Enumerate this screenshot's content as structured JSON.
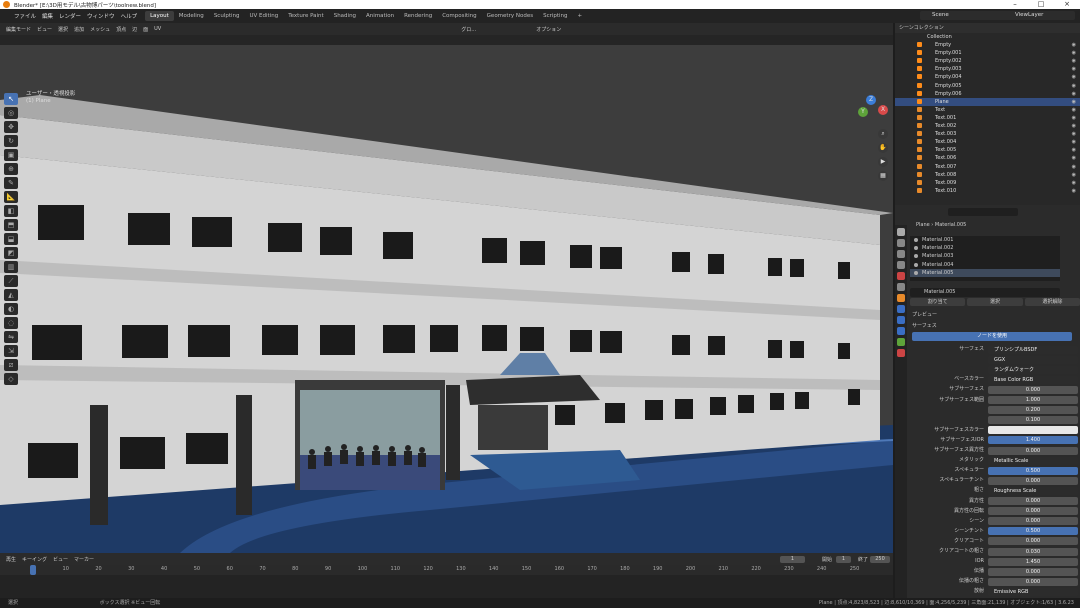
{
  "titlebar": {
    "title": "Blender* [E:\\3D用モデル\\古物博パーツ\\toolnew.blend]"
  },
  "menu": [
    "ファイル",
    "編集",
    "レンダー",
    "ウィンドウ",
    "ヘルプ"
  ],
  "workspaces": [
    "Layout",
    "Modeling",
    "Sculpting",
    "UV Editing",
    "Texture Paint",
    "Shading",
    "Animation",
    "Rendering",
    "Compositing",
    "Geometry Nodes",
    "Scripting",
    "+"
  ],
  "scene": "Scene",
  "view_layer": "ViewLayer",
  "viewport_header": [
    "編集モード",
    "ビュー",
    "選択",
    "追加",
    "メッシュ",
    "頂点",
    "辺",
    "面",
    "UV"
  ],
  "viewport_header_right": [
    "グロ…",
    "オプション"
  ],
  "viewport_info": {
    "line1": "ユーザー・透視投影",
    "line2": "(1) Plane"
  },
  "outliner": {
    "header": "シーンコレクション",
    "collection": "Collection",
    "items": [
      "Empty",
      "Empty.001",
      "Empty.002",
      "Empty.003",
      "Empty.004",
      "Empty.005",
      "Empty.006",
      "Plane",
      "Text",
      "Text.001",
      "Text.002",
      "Text.003",
      "Text.004",
      "Text.005",
      "Text.006",
      "Text.007",
      "Text.008",
      "Text.009",
      "Text.010"
    ],
    "selected": "Plane"
  },
  "properties": {
    "breadcrumb_obj": "Plane",
    "breadcrumb_mat": "Material.005",
    "materials": [
      "Material.001",
      "Material.002",
      "Material.003",
      "Material.004",
      "Material.005"
    ],
    "material_name": "Material.005",
    "buttons": [
      "割り当て",
      "選択",
      "選択解除"
    ],
    "section_preview": "プレビュー",
    "section_surface": "サーフェス",
    "use_nodes": "ノードを使用",
    "rows": [
      {
        "label": "サーフェス",
        "value": "プリンシプルBSDF",
        "kind": "dark"
      },
      {
        "label": "",
        "value": "GGX",
        "kind": "dark"
      },
      {
        "label": "",
        "value": "ランダムウォーク",
        "kind": "dark"
      },
      {
        "label": "ベースカラー",
        "value": "Base Color RGB",
        "kind": "dark"
      },
      {
        "label": "サブサーフェス",
        "value": "0.000",
        "kind": ""
      },
      {
        "label": "サブサーフェス範囲",
        "value": "1.000",
        "kind": ""
      },
      {
        "label": "",
        "value": "0.200",
        "kind": ""
      },
      {
        "label": "",
        "value": "0.100",
        "kind": ""
      },
      {
        "label": "サブサーフェスカラー",
        "value": "",
        "kind": "white"
      },
      {
        "label": "サブサーフェスIOR",
        "value": "1.400",
        "kind": "blue"
      },
      {
        "label": "サブサーフェス異方性",
        "value": "0.000",
        "kind": ""
      },
      {
        "label": "メタリック",
        "value": "Metallic Scale",
        "kind": "dark"
      },
      {
        "label": "スペキュラー",
        "value": "0.500",
        "kind": "blue"
      },
      {
        "label": "スペキュラーチント",
        "value": "0.000",
        "kind": ""
      },
      {
        "label": "粗さ",
        "value": "Roughness Scale",
        "kind": "dark"
      },
      {
        "label": "異方性",
        "value": "0.000",
        "kind": ""
      },
      {
        "label": "異方性の回転",
        "value": "0.000",
        "kind": ""
      },
      {
        "label": "シーン",
        "value": "0.000",
        "kind": ""
      },
      {
        "label": "シーンチント",
        "value": "0.500",
        "kind": "blue"
      },
      {
        "label": "クリアコート",
        "value": "0.000",
        "kind": ""
      },
      {
        "label": "クリアコートの粗さ",
        "value": "0.030",
        "kind": ""
      },
      {
        "label": "IOR",
        "value": "1.450",
        "kind": ""
      },
      {
        "label": "伝播",
        "value": "0.000",
        "kind": ""
      },
      {
        "label": "伝播の粗さ",
        "value": "0.000",
        "kind": ""
      },
      {
        "label": "放射",
        "value": "Emissive RGB",
        "kind": "dark"
      }
    ]
  },
  "timeline": {
    "header": [
      "再生",
      "キーイング",
      "ビュー",
      "マーカー"
    ],
    "current_frame": "1",
    "start_label": "開始",
    "start": "1",
    "end_label": "終了",
    "end": "250",
    "ticks": [
      "1",
      "10",
      "20",
      "30",
      "40",
      "50",
      "60",
      "70",
      "80",
      "90",
      "100",
      "110",
      "120",
      "130",
      "140",
      "150",
      "160",
      "170",
      "180",
      "190",
      "200",
      "210",
      "220",
      "230",
      "240",
      "250"
    ]
  },
  "statusbar": {
    "left": "選択",
    "mid": "ボックス選択 ※ビュー回転",
    "right": "Plane | 頂点:4,823/8,523 | 辺:8,610/10,369 | 面:4,256/5,239 | 三角面:21,139 | オブジェクト:1/63 | 3.6.23"
  }
}
